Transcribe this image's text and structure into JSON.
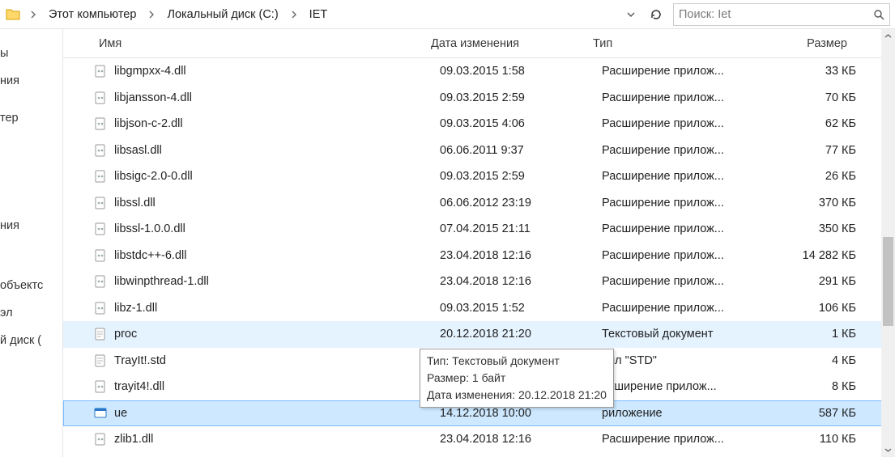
{
  "breadcrumb": {
    "seg1": "Этот компьютер",
    "seg2": "Локальный диск (C:)",
    "seg3": "IET"
  },
  "search": {
    "placeholder": "Поиск: Iet"
  },
  "nav": {
    "i0": "ы",
    "i1": "ния",
    "i2": "тер",
    "i3": "ния",
    "i4": "объектс",
    "i5": "эл",
    "i6": "й диск ("
  },
  "cols": {
    "name": "Имя",
    "date": "Дата изменения",
    "type": "Тип",
    "size": "Размер"
  },
  "tooltip": {
    "l1": "Тип: Текстовый документ",
    "l2": "Размер: 1 байт",
    "l3": "Дата изменения: 20.12.2018 21:20"
  },
  "rows": [
    {
      "icon": "dll",
      "name": "libgmpxx-4.dll",
      "date": "09.03.2015 1:58",
      "type": "Расширение прилож...",
      "size": "33 КБ"
    },
    {
      "icon": "dll",
      "name": "libjansson-4.dll",
      "date": "09.03.2015 2:59",
      "type": "Расширение прилож...",
      "size": "70 КБ"
    },
    {
      "icon": "dll",
      "name": "libjson-c-2.dll",
      "date": "09.03.2015 4:06",
      "type": "Расширение прилож...",
      "size": "62 КБ"
    },
    {
      "icon": "dll",
      "name": "libsasl.dll",
      "date": "06.06.2011 9:37",
      "type": "Расширение прилож...",
      "size": "77 КБ"
    },
    {
      "icon": "dll",
      "name": "libsigc-2.0-0.dll",
      "date": "09.03.2015 2:59",
      "type": "Расширение прилож...",
      "size": "26 КБ"
    },
    {
      "icon": "dll",
      "name": "libssl.dll",
      "date": "06.06.2012 23:19",
      "type": "Расширение прилож...",
      "size": "370 КБ"
    },
    {
      "icon": "dll",
      "name": "libssl-1.0.0.dll",
      "date": "07.04.2015 21:11",
      "type": "Расширение прилож...",
      "size": "350 КБ"
    },
    {
      "icon": "dll",
      "name": "libstdc++-6.dll",
      "date": "23.04.2018 12:16",
      "type": "Расширение прилож...",
      "size": "14 282 КБ"
    },
    {
      "icon": "dll",
      "name": "libwinpthread-1.dll",
      "date": "23.04.2018 12:16",
      "type": "Расширение прилож...",
      "size": "291 КБ"
    },
    {
      "icon": "dll",
      "name": "libz-1.dll",
      "date": "09.03.2015 1:52",
      "type": "Расширение прилож...",
      "size": "106 КБ"
    },
    {
      "icon": "txt",
      "name": "proc",
      "date": "20.12.2018 21:20",
      "type": "Текстовый документ",
      "size": "1 КБ",
      "sel": "light"
    },
    {
      "icon": "txt",
      "name": "TrayIt!.std",
      "date": "",
      "type": "айл \"STD\"",
      "size": "4 КБ"
    },
    {
      "icon": "dll",
      "name": "trayit4!.dll",
      "date": "",
      "type": "асширение прилож...",
      "size": "8 КБ"
    },
    {
      "icon": "exe",
      "name": "ue",
      "date": "14.12.2018 10:00",
      "type": "риложение",
      "size": "587 КБ",
      "sel": "focus"
    },
    {
      "icon": "dll",
      "name": "zlib1.dll",
      "date": "23.04.2018 12:16",
      "type": "Расширение прилож...",
      "size": "110 КБ"
    }
  ]
}
